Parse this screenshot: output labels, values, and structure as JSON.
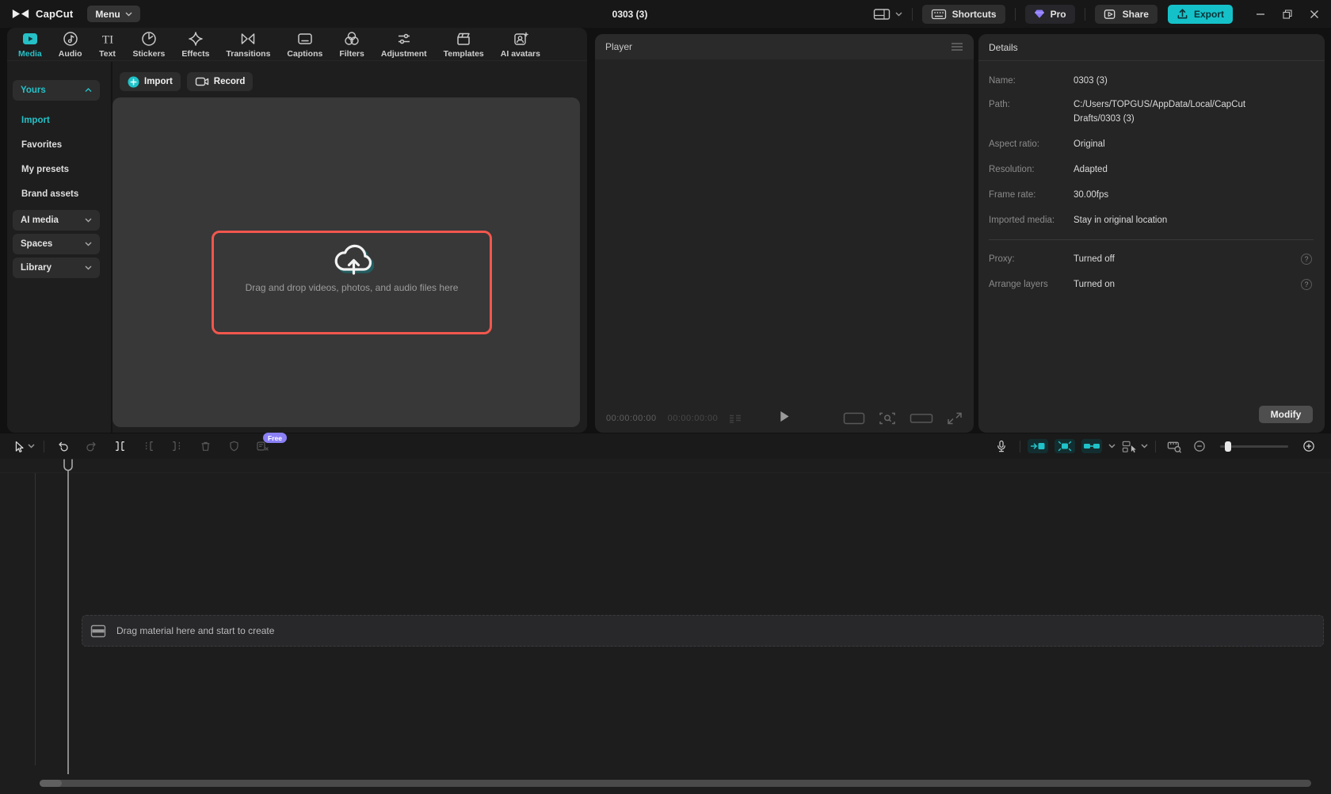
{
  "titlebar": {
    "logo_text": "CapCut",
    "menu_label": "Menu",
    "project_title": "0303 (3)",
    "shortcuts_label": "Shortcuts",
    "pro_label": "Pro",
    "share_label": "Share",
    "export_label": "Export"
  },
  "ribbon": {
    "tabs": [
      {
        "label": "Media",
        "active": true
      },
      {
        "label": "Audio"
      },
      {
        "label": "Text"
      },
      {
        "label": "Stickers"
      },
      {
        "label": "Effects"
      },
      {
        "label": "Transitions"
      },
      {
        "label": "Captions"
      },
      {
        "label": "Filters"
      },
      {
        "label": "Adjustment"
      },
      {
        "label": "Templates"
      },
      {
        "label": "AI avatars"
      }
    ]
  },
  "sidebar": {
    "yours_label": "Yours",
    "items": [
      {
        "label": "Import",
        "active": true
      },
      {
        "label": "Favorites"
      },
      {
        "label": "My presets"
      },
      {
        "label": "Brand assets"
      }
    ],
    "groups": [
      {
        "label": "AI media"
      },
      {
        "label": "Spaces"
      },
      {
        "label": "Library"
      }
    ]
  },
  "media_panel": {
    "import_label": "Import",
    "record_label": "Record",
    "dropzone_text": "Drag and drop videos, photos, and audio files here"
  },
  "player": {
    "title": "Player",
    "timecode_current": "00:00:00:00",
    "timecode_total": "00:00:00:00"
  },
  "details": {
    "title": "Details",
    "rows": [
      {
        "label": "Name:",
        "value": "0303 (3)"
      },
      {
        "label": "Path:",
        "value": "C:/Users/TOPGUS/AppData/Local/CapCut Drafts/0303 (3)"
      },
      {
        "label": "Aspect ratio:",
        "value": "Original"
      },
      {
        "label": "Resolution:",
        "value": "Adapted"
      },
      {
        "label": "Frame rate:",
        "value": "30.00fps"
      },
      {
        "label": "Imported media:",
        "value": "Stay in original location"
      }
    ],
    "toggles": [
      {
        "label": "Proxy:",
        "value": "Turned off"
      },
      {
        "label": "Arrange layers",
        "value": "Turned on"
      }
    ],
    "help_glyph": "?",
    "modify_label": "Modify"
  },
  "timeline": {
    "free_badge": "Free",
    "empty_text": "Drag material here and start to create"
  },
  "colors": {
    "accent": "#25c1c7",
    "export_bg": "#15c1c9",
    "dropzone": "#f2574d",
    "free_badge": "#8b80f6",
    "pro_gem": "#8d7bfa"
  }
}
